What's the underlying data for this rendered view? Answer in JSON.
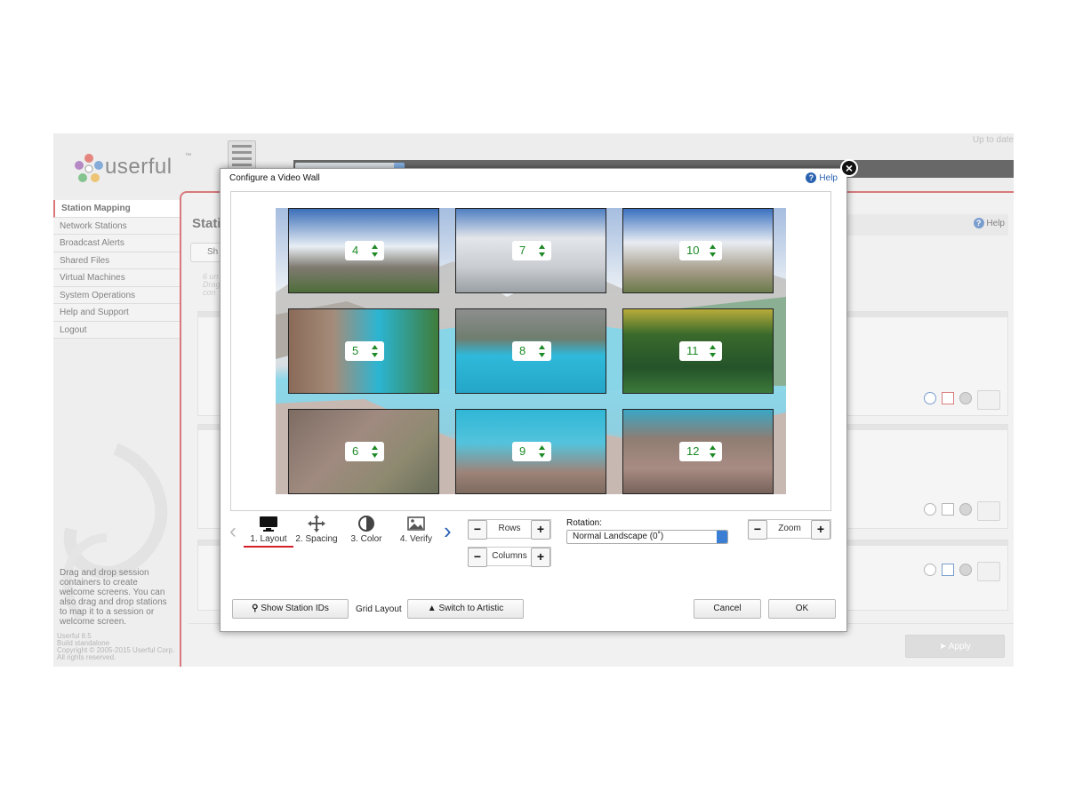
{
  "app": {
    "logo_text": "userful",
    "logo_trademark": "™",
    "topbar_update_text": "Up to date",
    "topbar_host": "..."
  },
  "sidebar": {
    "items": [
      {
        "label": "Station Mapping",
        "active": true
      },
      {
        "label": "Network Stations",
        "active": false
      },
      {
        "label": "Broadcast Alerts",
        "active": false
      },
      {
        "label": "Shared Files",
        "active": false
      },
      {
        "label": "Virtual Machines",
        "active": false
      },
      {
        "label": "System Operations",
        "active": false
      },
      {
        "label": "Help and Support",
        "active": false
      },
      {
        "label": "Logout",
        "active": false
      }
    ],
    "help_text": "Drag and drop session containers to create welcome screens. You can also drag and drop stations to map it to a session or welcome screen.",
    "version_lines": [
      "Userful 8.5",
      "Build standalone",
      "Copyright © 2005-2015 Userful Corp.",
      "All rights reserved."
    ]
  },
  "main": {
    "title_partial": "Stati",
    "help_label": "Help",
    "search_partial": "Sh",
    "faded_text": [
      "6 un",
      "Drag",
      "con"
    ],
    "apply_label": "Apply"
  },
  "modal": {
    "title": "Configure a Video Wall",
    "help_label": "Help",
    "close_symbol": "×",
    "tiles": [
      {
        "id": "4"
      },
      {
        "id": "7"
      },
      {
        "id": "10"
      },
      {
        "id": "5"
      },
      {
        "id": "8"
      },
      {
        "id": "11"
      },
      {
        "id": "6"
      },
      {
        "id": "9"
      },
      {
        "id": "12"
      }
    ],
    "tabs": [
      {
        "label": "1. Layout",
        "icon": "monitor-icon",
        "active": true
      },
      {
        "label": "2. Spacing",
        "icon": "move-icon",
        "active": false
      },
      {
        "label": "3. Color",
        "icon": "contrast-icon",
        "active": false
      },
      {
        "label": "4. Verify",
        "icon": "image-icon",
        "active": false
      }
    ],
    "rows_label": "Rows",
    "columns_label": "Columns",
    "zoom_label": "Zoom",
    "rotation": {
      "label": "Rotation:",
      "selected": "Normal Landscape (0˚)"
    },
    "show_station_ids_label": "Show Station IDs",
    "grid_layout_label": "Grid Layout",
    "switch_artistic_label": "Switch to Artistic",
    "cancel_label": "Cancel",
    "ok_label": "OK",
    "minus_symbol": "−",
    "plus_symbol": "+"
  },
  "colors": {
    "accent_red": "#c0282d",
    "help_blue": "#2a62b0",
    "label_green": "#1d8a25"
  }
}
